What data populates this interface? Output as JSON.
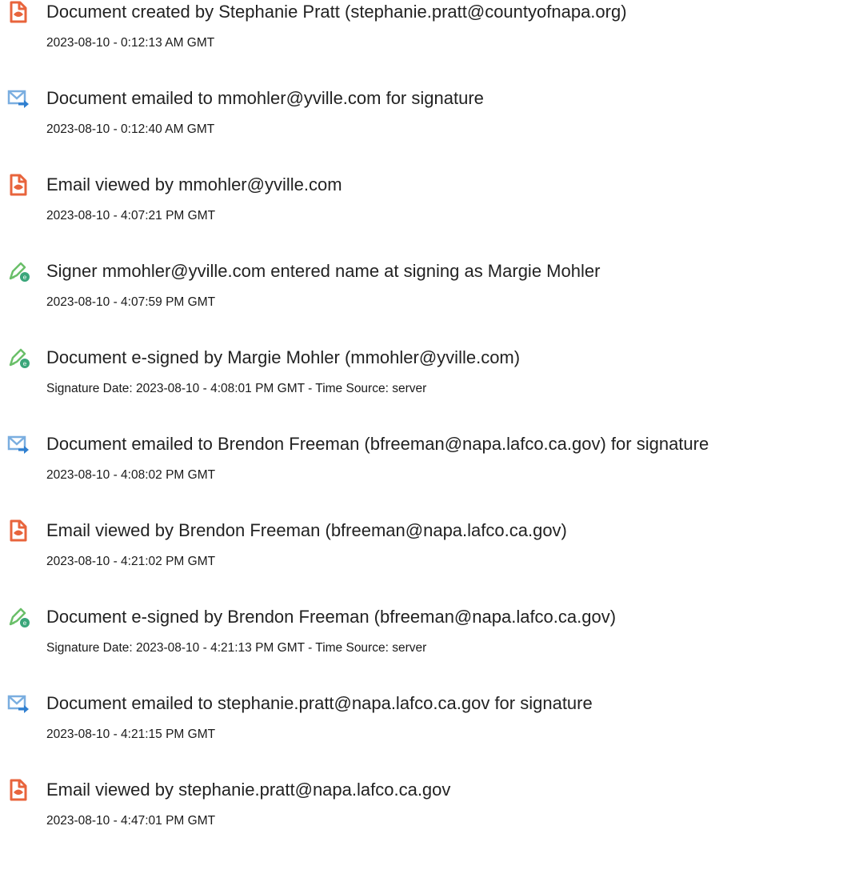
{
  "audit_trail": {
    "events": [
      {
        "icon": "document-created-icon",
        "title": "Document created by Stephanie Pratt (stephanie.pratt@countyofnapa.org)",
        "detail": "2023-08-10 - 0:12:13 AM GMT"
      },
      {
        "icon": "email-sent-icon",
        "title": "Document emailed to mmohler@yville.com for signature",
        "detail": "2023-08-10 - 0:12:40 AM GMT"
      },
      {
        "icon": "document-viewed-icon",
        "title": "Email viewed by mmohler@yville.com",
        "detail": "2023-08-10 - 4:07:21 PM GMT"
      },
      {
        "icon": "e-sign-pen-icon",
        "title": "Signer mmohler@yville.com entered name at signing as Margie Mohler",
        "detail": "2023-08-10 - 4:07:59 PM GMT"
      },
      {
        "icon": "e-sign-pen-icon",
        "title": "Document e-signed by Margie Mohler (mmohler@yville.com)",
        "detail": "Signature Date: 2023-08-10 - 4:08:01 PM GMT - Time Source: server"
      },
      {
        "icon": "email-sent-icon",
        "title": "Document emailed to Brendon Freeman (bfreeman@napa.lafco.ca.gov) for signature",
        "detail": "2023-08-10 - 4:08:02 PM GMT"
      },
      {
        "icon": "document-viewed-icon",
        "title": "Email viewed by Brendon Freeman (bfreeman@napa.lafco.ca.gov)",
        "detail": "2023-08-10 - 4:21:02 PM GMT"
      },
      {
        "icon": "e-sign-pen-icon",
        "title": "Document e-signed by Brendon Freeman (bfreeman@napa.lafco.ca.gov)",
        "detail": "Signature Date: 2023-08-10 - 4:21:13 PM GMT - Time Source: server"
      },
      {
        "icon": "email-sent-icon",
        "title": "Document emailed to stephanie.pratt@napa.lafco.ca.gov for signature",
        "detail": "2023-08-10 - 4:21:15 PM GMT"
      },
      {
        "icon": "document-viewed-icon",
        "title": "Email viewed by stephanie.pratt@napa.lafco.ca.gov",
        "detail": "2023-08-10 - 4:47:01 PM GMT"
      }
    ]
  },
  "colors": {
    "document_icon": "#e8643c",
    "email_icon_envelope": "#7aaee0",
    "email_icon_arrow": "#2f7fd0",
    "pen_icon": "#6abf69",
    "pen_badge": "#3aa67a"
  }
}
